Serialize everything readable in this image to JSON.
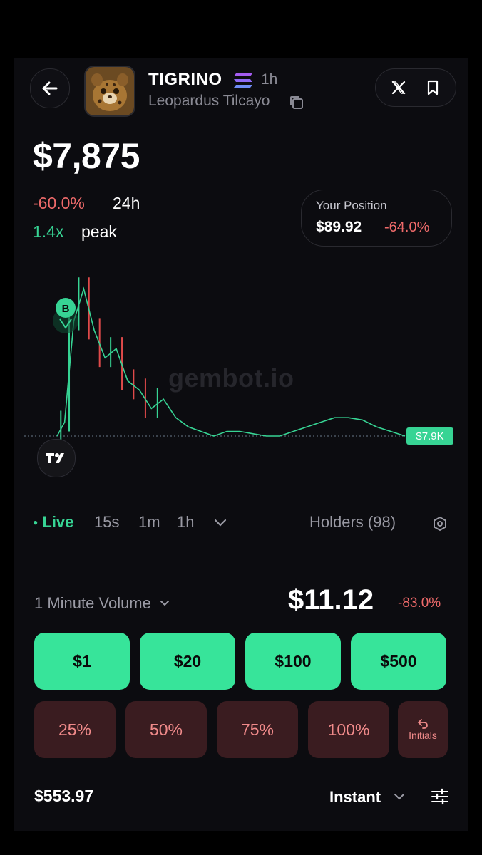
{
  "header": {
    "token_name": "TIGRINO",
    "age": "1h",
    "full_name": "Leopardus Tilcayo",
    "icons": [
      "back-arrow-icon",
      "solana-icon",
      "copy-icon",
      "x-logo-icon",
      "bookmark-icon"
    ]
  },
  "price": {
    "current": "$7,875",
    "change_24h": "-60.0%",
    "change_24h_label": "24h",
    "peak_multiple": "1.4x",
    "peak_label": "peak"
  },
  "position": {
    "label": "Your Position",
    "value": "$89.92",
    "change": "-64.0%"
  },
  "chart": {
    "watermark": "gembot.io",
    "last_price_tag": "$7.9K",
    "buy_marker": "B"
  },
  "chart_data": {
    "type": "candlestick-line",
    "series": [
      {
        "values": [
          7.9,
          8.2,
          10.4,
          11.1,
          10.2,
          9.6,
          9.8,
          9.1,
          8.9,
          8.5,
          8.7,
          8.3,
          8.1,
          8.0,
          7.9,
          8.0,
          8.0,
          7.95,
          7.9,
          7.9,
          8.0,
          8.1,
          8.2,
          8.3,
          8.3,
          8.25,
          8.1,
          8.0,
          7.9
        ]
      }
    ],
    "colors": {
      "up": "#37d494",
      "down": "#e04a4a"
    }
  },
  "timeframes": {
    "live": "Live",
    "options": [
      "15s",
      "1m",
      "1h"
    ],
    "holders": "Holders (98)"
  },
  "volume": {
    "label": "1 Minute Volume",
    "value": "$11.12",
    "change": "-83.0%"
  },
  "buy_amounts": [
    "$1",
    "$20",
    "$100",
    "$500"
  ],
  "sell_percents": [
    "25%",
    "50%",
    "75%",
    "100%"
  ],
  "initials_label": "Initials",
  "footer": {
    "balance": "$553.97",
    "mode": "Instant"
  },
  "colors": {
    "accent_green": "#37e49a",
    "negative_red": "#ee6a6a",
    "sell_bg": "#3a1c20",
    "background": "#0c0c10"
  }
}
